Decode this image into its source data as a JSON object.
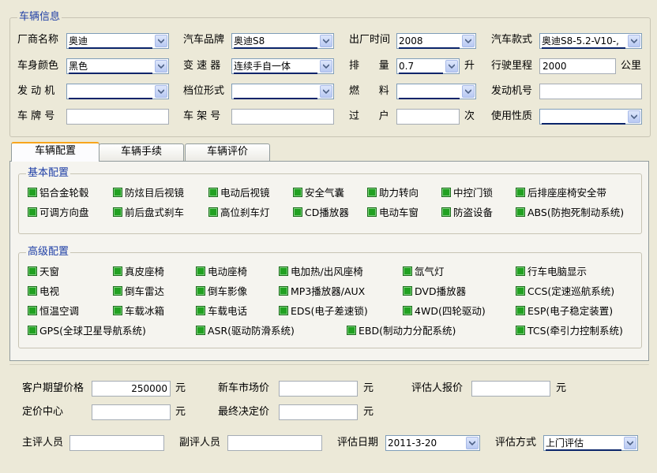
{
  "vehicle_info": {
    "title": "车辆信息",
    "manufacturer_label": "厂商名称",
    "manufacturer_value": "奥迪",
    "brand_label": "汽车品牌",
    "brand_value": "奥迪S8",
    "date_label": "出厂时间",
    "date_value": "2008",
    "model_label": "汽车款式",
    "model_value": "奥迪S8-5.2-V10-,",
    "color_label": "车身颜色",
    "color_value": "黑色",
    "gearbox_label": "变 速 器",
    "gearbox_value": "连续手自一体",
    "displacement_label": "排      量",
    "displacement_value": "0.7",
    "displacement_unit": "升",
    "mileage_label": "行驶里程",
    "mileage_value": "2000",
    "mileage_unit": "公里",
    "engine_label": "发 动 机",
    "engine_value": "",
    "gearshift_label": "档位形式",
    "gearshift_value": "",
    "fuel_label": "燃      料",
    "fuel_value": "",
    "engine_no_label": "发动机号",
    "engine_no_value": "",
    "plate_label": "车 牌 号",
    "plate_value": "",
    "frame_label": "车 架 号",
    "frame_value": "",
    "transfer_label": "过      户",
    "transfer_value": "",
    "transfer_unit": "次",
    "usage_label": "使用性质",
    "usage_value": ""
  },
  "tabs": [
    "车辆配置",
    "车辆手续",
    "车辆评价"
  ],
  "basic_config": {
    "title": "基本配置",
    "items": [
      "铝合金轮毂",
      "防炫目后视镜",
      "电动后视镜",
      "安全气囊",
      "助力转向",
      "中控门锁",
      "后排座座椅安全带",
      "可调方向盘",
      "前后盘式刹车",
      "高位刹车灯",
      "CD播放器",
      "电动车窗",
      "防盗设备",
      "ABS(防抱死制动系统)"
    ]
  },
  "advanced_config": {
    "title": "高级配置",
    "items": [
      "天窗",
      "真皮座椅",
      "电动座椅",
      "电加热/出风座椅",
      "氙气灯",
      "行车电脑显示",
      "电视",
      "倒车雷达",
      "倒车影像",
      "MP3播放器/AUX",
      "DVD播放器",
      "CCS(定速巡航系统)",
      "恒温空调",
      "车载冰箱",
      "车载电话",
      "EDS(电子差速锁)",
      "4WD(四轮驱动)",
      "ESP(电子稳定装置)",
      "GPS(全球卫星导航系统)",
      "ASR(驱动防滑系统)",
      "EBD(制动力分配系统)",
      "TCS(牵引力控制系统)"
    ]
  },
  "pricing": {
    "expected_label": "客户期望价格",
    "expected_value": "250000",
    "expected_unit": "元",
    "market_label": "新车市场价",
    "market_value": "",
    "market_unit": "元",
    "appraiser_label": "评估人报价",
    "appraiser_value": "",
    "appraiser_unit": "元",
    "center_label": "定价中心",
    "center_value": "",
    "center_unit": "元",
    "final_label": "最终决定价",
    "final_value": "",
    "final_unit": "元",
    "chief_label": "主评人员",
    "chief_value": "",
    "deputy_label": "副评人员",
    "deputy_value": "",
    "eval_date_label": "评估日期",
    "eval_date_value": "2011-3-20",
    "eval_method_label": "评估方式",
    "eval_method_value": "上门评估"
  }
}
